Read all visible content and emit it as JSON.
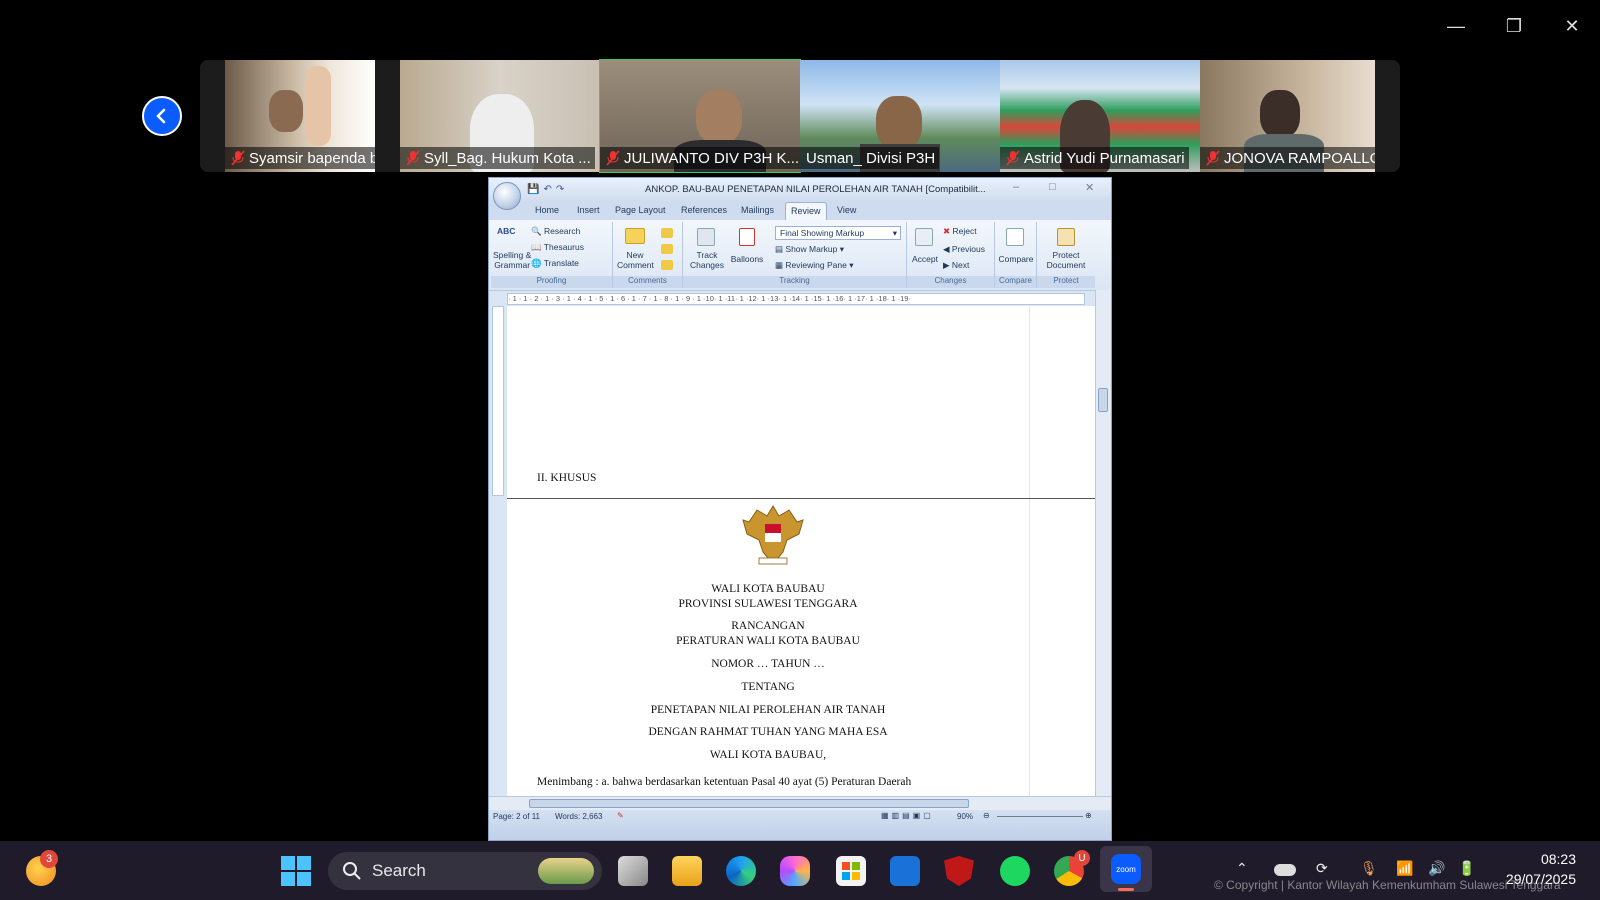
{
  "window_controls": {
    "minimize": "—",
    "restore": "❐",
    "close": "✕"
  },
  "participants": [
    {
      "name": "Syamsir bapenda baub...",
      "muted": true
    },
    {
      "name": "Syll_Bag. Hukum Kota ...",
      "muted": true
    },
    {
      "name": "JULIWANTO DIV P3H K...",
      "muted": true,
      "active": true
    },
    {
      "name": "Usman_ Divisi P3H",
      "muted": false
    },
    {
      "name": "Astrid Yudi Purnamasari",
      "muted": true
    },
    {
      "name": "JONOVA RAMPOALLO",
      "muted": true
    }
  ],
  "word": {
    "title": "ANKOP. BAU-BAU PENETAPAN NILAI PEROLEHAN AIR TANAH [Compatibilit...",
    "tabs": [
      "Home",
      "Insert",
      "Page Layout",
      "References",
      "Mailings",
      "Review",
      "View"
    ],
    "selected_tab": "Review",
    "ribbon": {
      "proofing": {
        "name": "Proofing",
        "spelling": "ABC",
        "spelling_label": "Spelling &",
        "spelling_label2": "Grammar",
        "research": "Research",
        "thesaurus": "Thesaurus",
        "translate": "Translate"
      },
      "comments": {
        "name": "Comments",
        "new": "New",
        "new2": "Comment"
      },
      "tracking": {
        "name": "Tracking",
        "track": "Track",
        "track2": "Changes",
        "balloons": "Balloons",
        "markup_select": "Final Showing Markup",
        "show_markup": "Show Markup",
        "reviewing_pane": "Reviewing Pane"
      },
      "changes": {
        "name": "Changes",
        "accept": "Accept",
        "reject": "Reject",
        "previous": "Previous",
        "next": "Next"
      },
      "compare": {
        "name": "Compare",
        "label": "Compare"
      },
      "protect": {
        "name": "Protect",
        "label": "Protect",
        "label2": "Document"
      }
    },
    "ruler_marks": "· 1 · 1 · 2 · 1 · 3 · 1 · 4 · 1 · 5 · 1 · 6 · 1 · 7 · 1 · 8 · 1 · 9 · 1 ·10· 1 ·11· 1 ·12· 1 ·13· 1 ·14· 1 ·15· 1 ·16· 1 ·17· 1 ·18· 1 ·19·",
    "doc": {
      "section_heading": "II. KHUSUS",
      "lines": [
        "WALI KOTA BAUBAU",
        "PROVINSI SULAWESI TENGGARA",
        "RANCANGAN",
        "PERATURAN WALI KOTA BAUBAU",
        "NOMOR … TAHUN …",
        "TENTANG",
        "PENETAPAN NILAI PEROLEHAN AIR TANAH",
        "DENGAN RAHMAT TUHAN YANG MAHA ESA",
        "WALI KOTA BAUBAU,"
      ],
      "menimbang": "Menimbang  : a.  bahwa berdasarkan ketentuan Pasal 40 ayat (5) Peraturan Daerah"
    },
    "status": {
      "page": "Page: 2 of 11",
      "words": "Words: 2,663",
      "zoom": "90%"
    }
  },
  "taskbar": {
    "search": "Search",
    "weather_badge": "3",
    "chrome_badge": "U",
    "time": "08:23",
    "date": "29/07/2025"
  },
  "watermark": "© Copyright | Kantor Wilayah Kemenkumham Sulawesi Tenggara"
}
